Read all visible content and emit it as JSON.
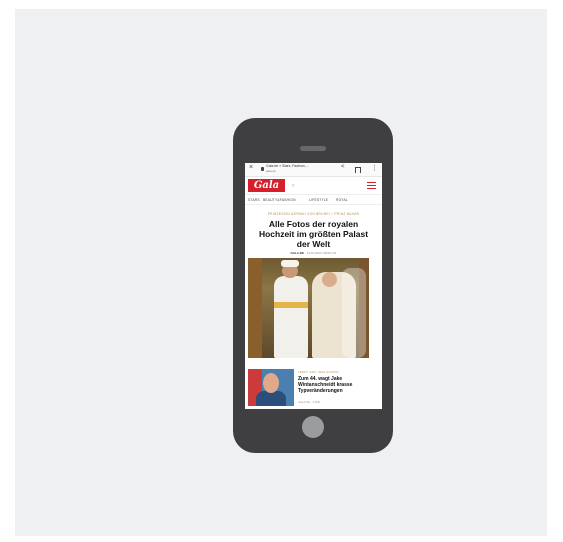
{
  "browser": {
    "close_glyph": "×",
    "page_title": "Gala.de » Stars, Fashion,…",
    "domain": "gala.de",
    "share_glyph": "<",
    "menu_glyph": "⋮"
  },
  "site": {
    "logo_text": "Gala",
    "search_label": "Q",
    "nav": [
      "STARS",
      "BEAUTY&FASHION",
      "LIFESTYLE",
      "ROYAL"
    ]
  },
  "article": {
    "kicker": "PRINZESSIN AZEMAH VON BRUNEI + PRINZ BAHAR",
    "headline": "Alle Fotos der royalen Hochzeit im größten Palast der Welt",
    "author": "GALA.DE",
    "date": "· 14.01.2023, 08:00 Uhr"
  },
  "teaser": {
    "kicker": "TEDDY SAFI, WAS GUCKST",
    "title": "Zum 44. wagt Jake Wintanschneidt krasse Typveränderungen",
    "meta": "GALA.DE · 2 MIN"
  },
  "colors": {
    "brand_red": "#d51f2a",
    "kicker_gold": "#b0905a",
    "phone_body": "#3f3f41"
  }
}
